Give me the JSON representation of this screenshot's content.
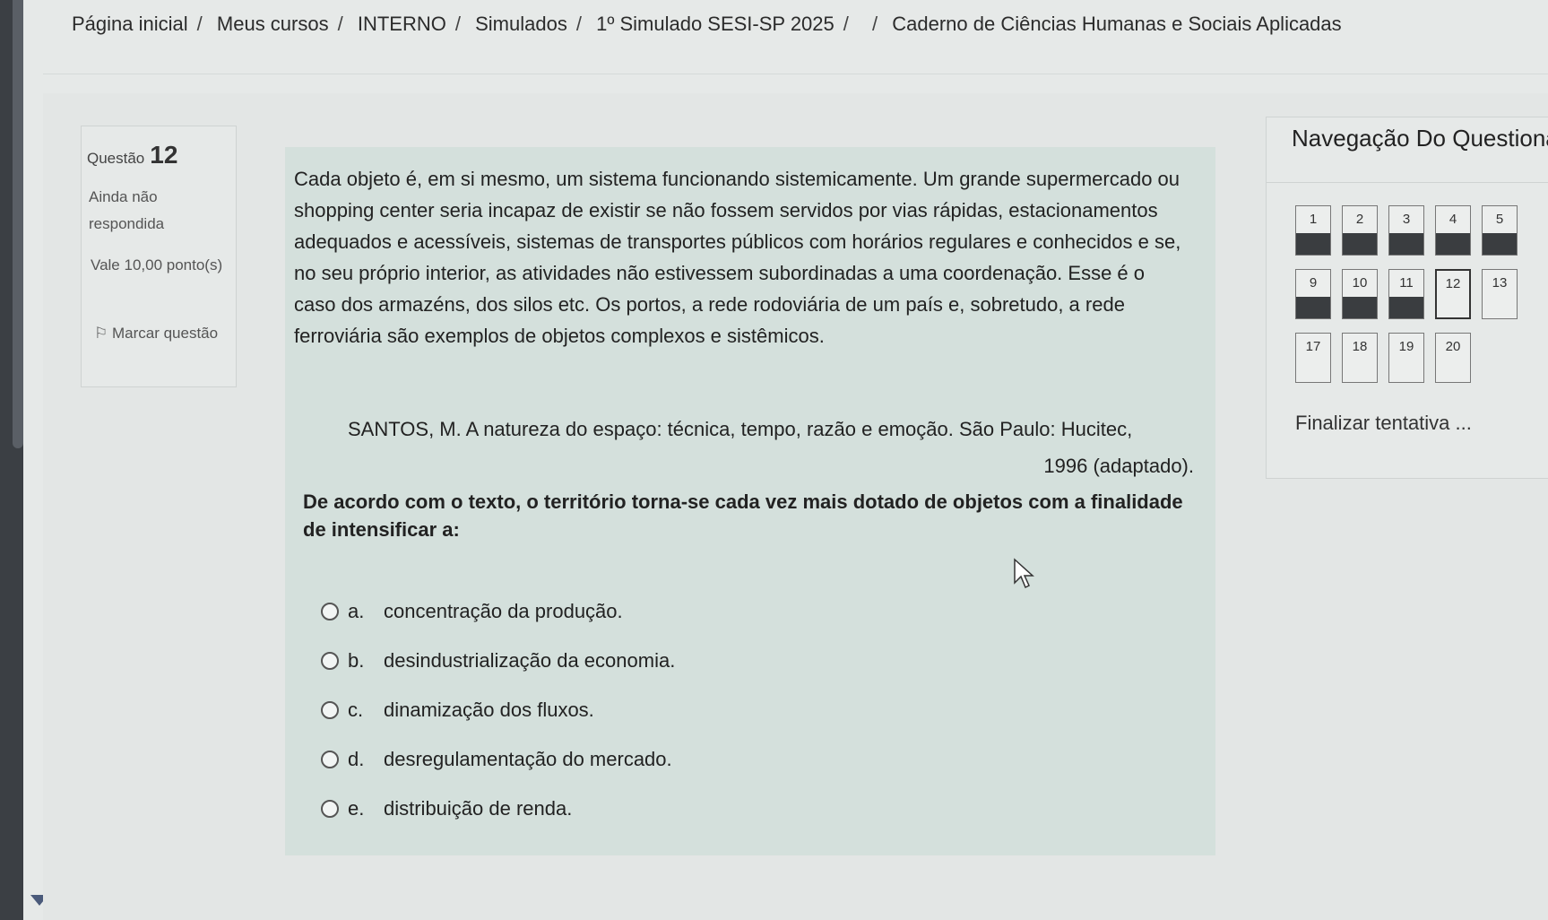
{
  "breadcrumb": {
    "items": [
      "Página inicial",
      "Meus cursos",
      "INTERNO",
      "Simulados",
      "1º Simulado SESI-SP 2025",
      "",
      "Caderno de Ciências Humanas e Sociais Aplicadas"
    ]
  },
  "question_info": {
    "label": "Questão",
    "number": "12",
    "state": "Ainda não respondida",
    "grade": "Vale 10,00 ponto(s)",
    "flag": "Marcar questão"
  },
  "question": {
    "text": "Cada objeto é, em si mesmo, um sistema funcionando sistemicamente. Um grande supermercado ou shopping center seria incapaz de existir se não fossem servidos por vias rápidas, estacionamentos adequados e acessíveis, sistemas de transportes públicos com horários regulares e conhecidos e se, no seu próprio interior, as atividades não estivessem subordinadas a uma coordenação. Esse é o caso dos armazéns, dos silos etc. Os portos, a rede rodoviária de um país e, sobretudo, a rede ferroviária são exemplos de objetos complexos e sistêmicos.",
    "reference_line1": "SANTOS, M. A natureza do espaço: técnica, tempo, razão e emoção. São Paulo: Hucitec,",
    "reference_line2": "1996 (adaptado).",
    "prompt": "De acordo com o texto, o território torna-se cada vez mais dotado de objetos com a finalidade de intensificar a:",
    "answers": [
      {
        "letter": "a.",
        "text": "concentração da produção."
      },
      {
        "letter": "b.",
        "text": "desindustrialização da economia."
      },
      {
        "letter": "c.",
        "text": "dinamização dos fluxos."
      },
      {
        "letter": "d.",
        "text": "desregulamentação do mercado."
      },
      {
        "letter": "e.",
        "text": "distribuição de renda."
      }
    ]
  },
  "navigation": {
    "title": "Navegação Do Questionário",
    "buttons": [
      {
        "label": "1",
        "answered": true
      },
      {
        "label": "2",
        "answered": true
      },
      {
        "label": "3",
        "answered": true
      },
      {
        "label": "4",
        "answered": true
      },
      {
        "label": "5",
        "answered": true
      },
      {
        "label": "9",
        "answered": true
      },
      {
        "label": "10",
        "answered": true
      },
      {
        "label": "11",
        "answered": true
      },
      {
        "label": "12",
        "answered": false,
        "current": true
      },
      {
        "label": "13",
        "answered": false
      },
      {
        "label": "17",
        "answered": false
      },
      {
        "label": "18",
        "answered": false
      },
      {
        "label": "19",
        "answered": false
      },
      {
        "label": "20",
        "answered": false
      }
    ],
    "finish": "Finalizar tentativa ..."
  }
}
